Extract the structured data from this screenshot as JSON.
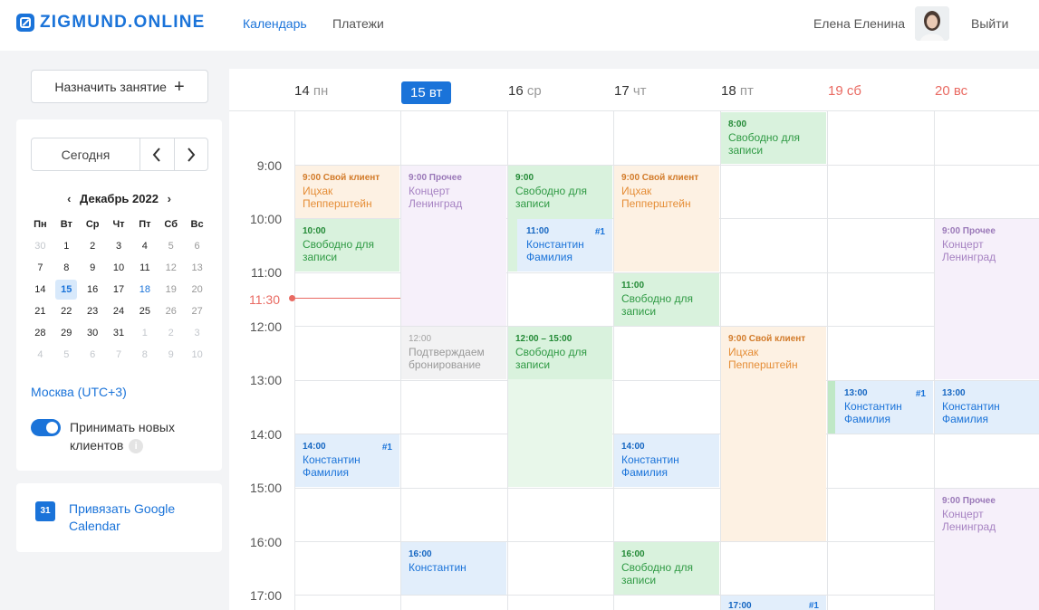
{
  "header": {
    "logo": "ZIGMUND.ONLINE",
    "nav": {
      "calendar": "Календарь",
      "payments": "Платежи"
    },
    "user_name": "Елена Еленина",
    "logout": "Выйти"
  },
  "sidebar": {
    "assign_button": "Назначить занятие",
    "today_button": "Сегодня",
    "month_label": "Декабрь 2022",
    "weekdays": [
      "Пн",
      "Вт",
      "Ср",
      "Чт",
      "Пт",
      "Сб",
      "Вс"
    ],
    "weeks": [
      [
        "30",
        "1",
        "2",
        "3",
        "4",
        "5",
        "6"
      ],
      [
        "7",
        "8",
        "9",
        "10",
        "11",
        "12",
        "13"
      ],
      [
        "14",
        "15",
        "16",
        "17",
        "18",
        "19",
        "20"
      ],
      [
        "21",
        "22",
        "23",
        "24",
        "25",
        "26",
        "27"
      ],
      [
        "28",
        "29",
        "30",
        "31",
        "1",
        "2",
        "3"
      ],
      [
        "4",
        "5",
        "6",
        "7",
        "8",
        "9",
        "10"
      ]
    ],
    "timezone": "Москва (UTC+3)",
    "accept_toggle_label": "Принимать новых клиентов",
    "accept_toggle_on": true,
    "google_link": "Привязать Google Calendar",
    "google_icon_text": "31"
  },
  "calendar": {
    "days": [
      {
        "num": "14",
        "dow": "пн"
      },
      {
        "num": "15",
        "dow": "вт"
      },
      {
        "num": "16",
        "dow": "ср"
      },
      {
        "num": "17",
        "dow": "чт"
      },
      {
        "num": "18",
        "dow": "пт"
      },
      {
        "num": "19",
        "dow": "сб"
      },
      {
        "num": "20",
        "dow": "вс"
      }
    ],
    "times": [
      "9:00",
      "10:00",
      "11:00",
      "12:00",
      "13:00",
      "14:00",
      "15:00",
      "16:00",
      "17:00"
    ],
    "now_label": "11:30",
    "events": {
      "mon_0900": {
        "time": "9:00 Свой клиент",
        "title": "Ицхак Пепперштейн"
      },
      "mon_1000": {
        "time": "10:00",
        "title": "Свободно для записи"
      },
      "mon_1400": {
        "time": "14:00",
        "num": "#1",
        "title": "Константин Фамилия"
      },
      "tue_0900": {
        "time": "9:00 Прочее",
        "title": "Концерт Ленинград"
      },
      "tue_1200": {
        "time": "12:00",
        "title": "Подтверждаем бронирование"
      },
      "tue_1600": {
        "time": "16:00",
        "title": "Константин"
      },
      "wed_0900": {
        "time": "9:00",
        "title": "Свободно для записи"
      },
      "wed_1100": {
        "time": "11:00",
        "num": "#1",
        "title": "Константин Фамилия"
      },
      "wed_1200": {
        "time": "12:00 – 15:00",
        "title": "Свободно для записи"
      },
      "thu_0900": {
        "time": "9:00 Свой клиент",
        "title": "Ицхак Пепперштейн"
      },
      "thu_1100": {
        "time": "11:00",
        "title": "Свободно для записи"
      },
      "thu_1400": {
        "time": "14:00",
        "title": "Константин Фамилия"
      },
      "thu_1600": {
        "time": "16:00",
        "title": "Свободно для записи"
      },
      "fri_0800": {
        "time": "8:00",
        "title": "Свободно для записи"
      },
      "fri_1200": {
        "time": "9:00 Свой клиент",
        "title": "Ицхак Пепперштейн"
      },
      "fri_1700": {
        "time": "17:00",
        "num": "#1"
      },
      "sat_1300": {
        "time": "13:00",
        "num": "#1",
        "title": "Константин Фамилия"
      },
      "sun_1000": {
        "time": "9:00 Прочее",
        "title": "Концерт Ленинград"
      },
      "sun_1300": {
        "time": "13:00",
        "title": "Константин Фамилия"
      },
      "sun_1500": {
        "time": "9:00 Прочее",
        "title": "Концерт Ленинград"
      }
    }
  }
}
